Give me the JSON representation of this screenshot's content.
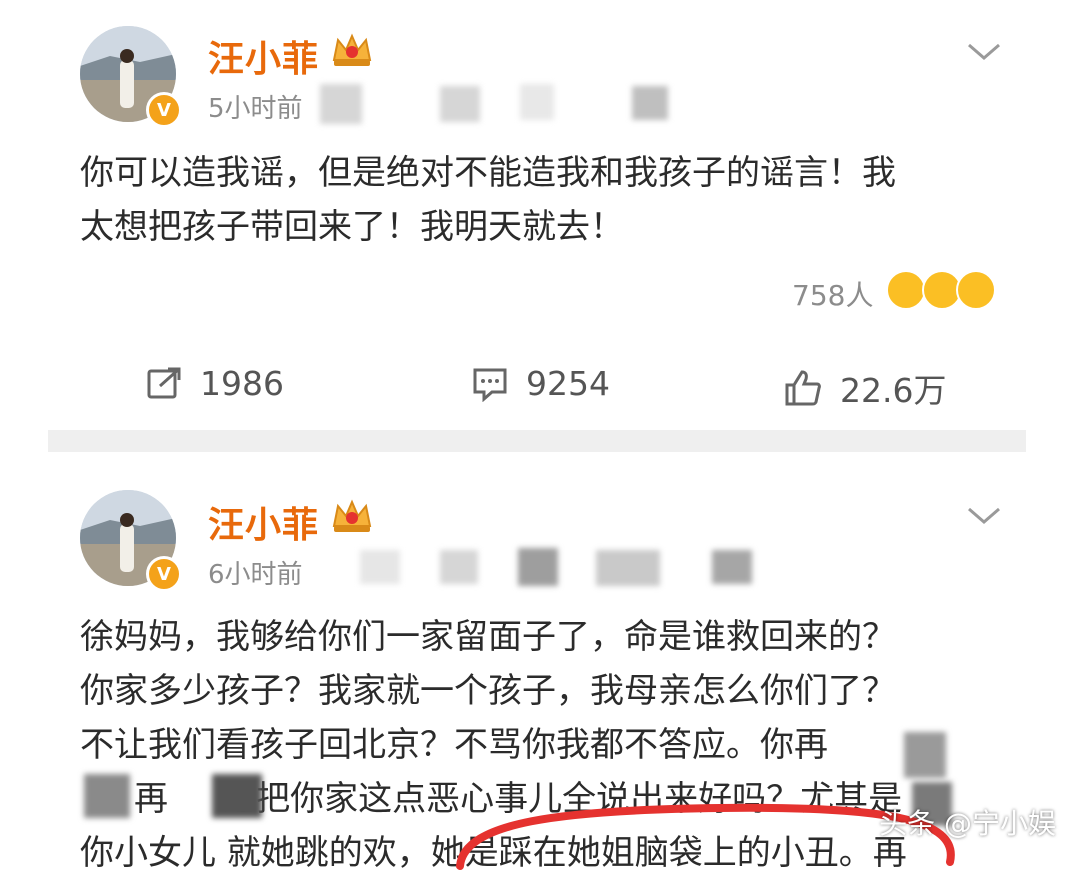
{
  "posts": [
    {
      "username": "汪小菲",
      "time": "5小时前",
      "content_lines": [
        "你可以造我谣，但是绝对不能造我和我孩子的谣言！我",
        "太想把孩子带回来了！我明天就去！"
      ],
      "reactions_count": "758人",
      "share_count": "1986",
      "comment_count": "9254",
      "like_count": "22.6万"
    },
    {
      "username": "汪小菲",
      "time": "6小时前",
      "content_lines": [
        "徐妈妈，我够给你们一家留面子了，命是谁救回来的？",
        "你家多少孩子？我家就一个孩子，我母亲怎么你们了？",
        "不让我们看孩子回北京？不骂你我都不答应。你再",
        "     再     逼把你家这点恶心事儿全说出来好吗？尤其是",
        "你小女儿 就她跳的欢，她是踩在她姐脑袋上的小丑。再"
      ]
    }
  ],
  "watermark": "头条 @宁小娱",
  "colors": {
    "username": "#e8690b",
    "verified_badge": "#f4a21a",
    "annotation_circle": "#e5322f"
  }
}
